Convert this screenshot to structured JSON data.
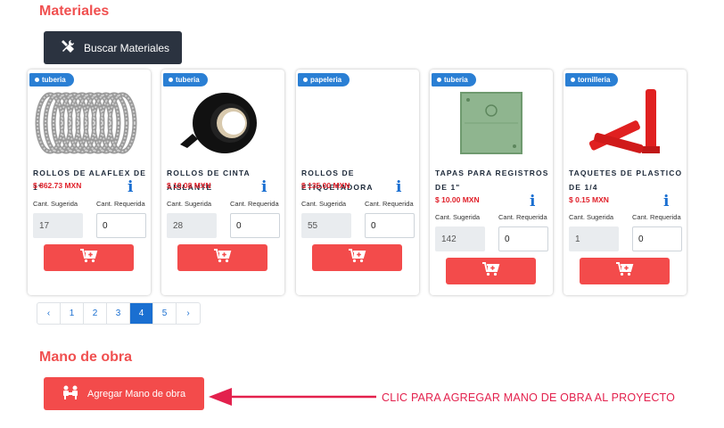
{
  "sections": {
    "materiales_title": "Materiales",
    "mano_obra_title": "Mano de obra"
  },
  "buttons": {
    "buscar_materiales": "Buscar Materiales",
    "agregar_mano_obra": "Agregar Mano de obra"
  },
  "products": [
    {
      "category": "tuberia",
      "name": "ROLLOS DE ALAFLEX DE 1\"",
      "price": "$ 862.73 MXN",
      "sugerida_label": "Cant. Sugerida",
      "requerida_label": "Cant. Requerida",
      "sugerida": "17",
      "requerida": "0",
      "image": "coiled-conduit"
    },
    {
      "category": "tuberia",
      "name": "ROLLOS DE CINTA AISLANTE",
      "price": "$ 19.08 MXN",
      "sugerida_label": "Cant. Sugerida",
      "requerida_label": "Cant. Requerida",
      "sugerida": "28",
      "requerida": "0",
      "image": "tape-roll"
    },
    {
      "category": "papeleria",
      "name": "ROLLOS DE ETIQUETADORA",
      "price": "$ 135.00 MXN",
      "sugerida_label": "Cant. Sugerida",
      "requerida_label": "Cant. Requerida",
      "sugerida": "55",
      "requerida": "0",
      "image": "none"
    },
    {
      "category": "tuberia",
      "name": "TAPAS PARA REGISTROS DE 1\"",
      "price": "$ 10.00 MXN",
      "sugerida_label": "Cant. Sugerida",
      "requerida_label": "Cant. Requerida",
      "sugerida": "142",
      "requerida": "0",
      "image": "green-box-cover"
    },
    {
      "category": "tornilleria",
      "name": "TAQUETES DE PLASTICO DE 1/4",
      "price": "$ 0.15 MXN",
      "sugerida_label": "Cant. Sugerida",
      "requerida_label": "Cant. Requerida",
      "sugerida": "1",
      "requerida": "0",
      "image": "red-anchors"
    }
  ],
  "pagination": {
    "prev": "‹",
    "pages": [
      "1",
      "2",
      "3",
      "4",
      "5"
    ],
    "active": "4",
    "next": "›"
  },
  "annotation": {
    "text": "CLIC PARA AGREGAR MANO DE OBRA AL PROYECTO",
    "color": "#e3214d"
  },
  "colors": {
    "accent_red": "#f34b4b",
    "dark_button": "#2b3340",
    "badge_blue": "#2a7fd4",
    "price_red": "#e0202a"
  },
  "icons": {
    "buscar": "tools-icon",
    "cart": "add-to-cart-icon",
    "mano_obra": "workers-icon",
    "info": "info-icon"
  }
}
